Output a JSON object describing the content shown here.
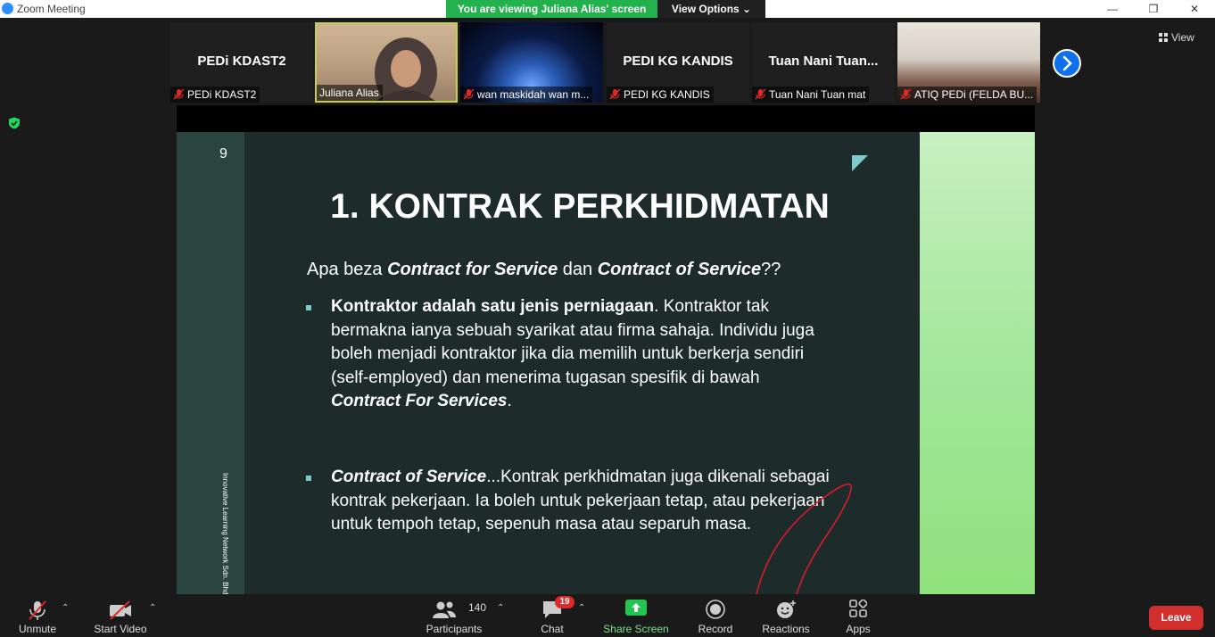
{
  "window": {
    "title": "Zoom Meeting",
    "minimize": "—",
    "maximize": "❐",
    "close": "✕"
  },
  "share_banner": {
    "text": "You are viewing Juliana Alias' screen",
    "view_options": "View Options ⌄"
  },
  "view_button": {
    "label": "View"
  },
  "participants_strip": [
    {
      "display": "PEDi KDAST2",
      "name": "PEDi KDAST2",
      "muted": true,
      "video": false
    },
    {
      "display": "",
      "name": "Juliana Alias",
      "muted": false,
      "video": true,
      "active_speaker": true
    },
    {
      "display": "",
      "name": "wan maskidah wan m...",
      "muted": true,
      "video": true
    },
    {
      "display": "PEDI KG KANDIS",
      "name": "PEDI KG KANDIS",
      "muted": true,
      "video": false
    },
    {
      "display": "Tuan  Nani  Tuan...",
      "name": "Tuan Nani Tuan mat",
      "muted": true,
      "video": false
    },
    {
      "display": "",
      "name": "ATIQ PEDi (FELDA BU...",
      "muted": true,
      "video": true
    }
  ],
  "slide": {
    "page_number": "9",
    "vertical_text": "Innovative Learning Network Sdn. Bhd.",
    "heading": "1. KONTRAK PERKHIDMATAN",
    "intro_prefix": "Apa beza ",
    "intro_term1": "Contract for Service",
    "intro_mid": " dan ",
    "intro_term2": "Contract of Service",
    "intro_suffix": "??",
    "bullet1_bold": "Kontraktor adalah satu jenis perniagaan",
    "bullet1_text": ". Kontraktor tak bermakna ianya sebuah syarikat atau firma sahaja. Individu juga boleh menjadi kontraktor jika dia memilih untuk berkerja sendiri (self-employed) dan menerima tugasan spesifik di bawah ",
    "bullet1_term": "Contract For Services",
    "bullet1_end": ".",
    "bullet2_term": "Contract of Service",
    "bullet2_text": "...Kontrak perkhidmatan juga dikenali sebagai kontrak pekerjaan. Ia boleh untuk pekerjaan tetap, atau pekerjaan untuk tempoh tetap, sepenuh masa atau separuh masa."
  },
  "toolbar": {
    "unmute": "Unmute",
    "start_video": "Start Video",
    "participants": "Participants",
    "participants_count": "140",
    "chat": "Chat",
    "chat_badge": "19",
    "share_screen": "Share Screen",
    "record": "Record",
    "reactions": "Reactions",
    "apps": "Apps",
    "leave": "Leave"
  },
  "colors": {
    "banner_green": "#22b14c",
    "slide_bg": "#1d2c2a",
    "accent_teal": "#7ecbcf",
    "leave_red": "#d12e2e",
    "annotation_red": "#d8192b"
  }
}
